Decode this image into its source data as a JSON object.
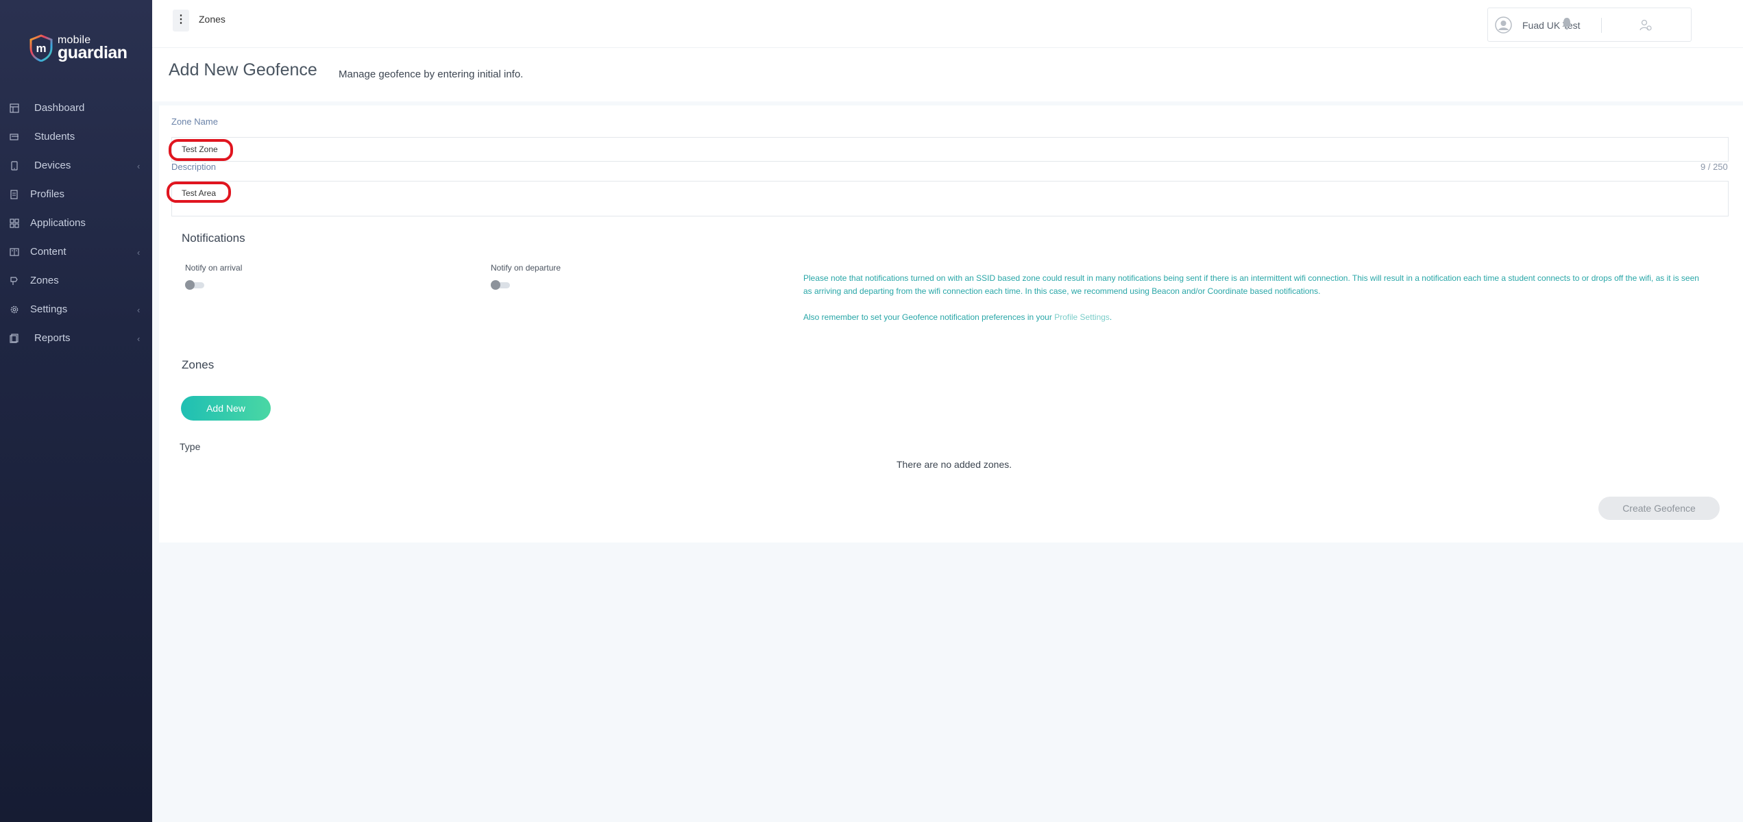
{
  "brand": {
    "line1": "mobile",
    "line2": "guardian"
  },
  "sidebar": {
    "items": [
      {
        "label": "Dashboard",
        "icon": "dashboard-icon",
        "has_chevron": false
      },
      {
        "label": "Students",
        "icon": "students-icon",
        "has_chevron": false
      },
      {
        "label": "Devices",
        "icon": "device-icon",
        "has_chevron": true
      },
      {
        "label": "Profiles",
        "icon": "profiles-icon",
        "has_chevron": false
      },
      {
        "label": "Applications",
        "icon": "applications-icon",
        "has_chevron": false
      },
      {
        "label": "Content",
        "icon": "content-icon",
        "has_chevron": true
      },
      {
        "label": "Zones",
        "icon": "zones-icon",
        "has_chevron": false
      },
      {
        "label": "Settings",
        "icon": "gear-icon",
        "has_chevron": true
      },
      {
        "label": "Reports",
        "icon": "reports-icon",
        "has_chevron": true
      }
    ],
    "chevron": "‹"
  },
  "topbar": {
    "menu_glyph": "⋮",
    "breadcrumb": "Zones",
    "user_name": "Fuad UK Test"
  },
  "page": {
    "title": "Add New Geofence",
    "subtitle": "Manage geofence by entering initial info."
  },
  "form": {
    "zone_name_label": "Zone Name",
    "zone_name_value": "Test Zone",
    "description_label": "Description",
    "description_value": "Test Area",
    "description_counter": "9 / 250"
  },
  "notifications": {
    "heading": "Notifications",
    "arrival_label": "Notify on arrival",
    "arrival_on": false,
    "departure_label": "Notify on departure",
    "departure_on": false,
    "warning_line1": "Please note that notifications turned on with an SSID based zone could result in many notifications being sent if there is an intermittent wifi connection. This will result in a notification each time a student connects to or drops off the wifi, as it is seen",
    "warning_line2": "as arriving and departing from the wifi connection each time. In this case, we recommend using Beacon and/or Coordinate based notifications.",
    "pref_text": "Also remember to set your Geofence notification preferences in your",
    "pref_link": "Profile Settings",
    "pref_end": "."
  },
  "zones": {
    "heading": "Zones",
    "add_button": "Add New",
    "type_header": "Type",
    "empty_text": "There are no added zones."
  },
  "actions": {
    "create_button": "Create Geofence"
  },
  "colors": {
    "accent": "#1fbfb3",
    "sidebar": "#1f2642",
    "highlight": "#e0151f",
    "note": "#28a6a7"
  }
}
